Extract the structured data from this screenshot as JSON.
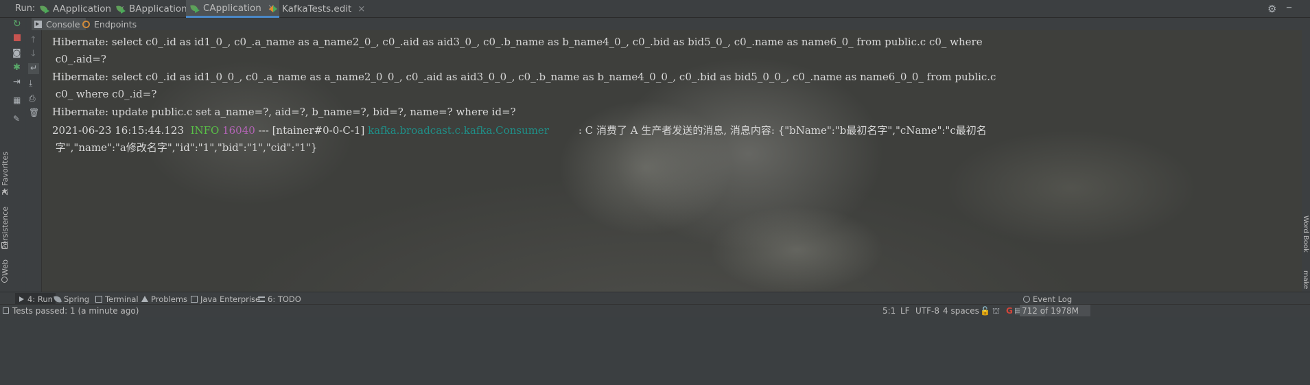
{
  "run_bar": {
    "label": "Run:",
    "tabs": [
      {
        "label": "AApplication",
        "close": "×"
      },
      {
        "label": "BApplication",
        "close": "×"
      },
      {
        "label": "CApplication",
        "close": "×"
      },
      {
        "label": "KafkaTests.edit",
        "close": "×"
      }
    ],
    "settings_icon": "gear-icon",
    "minimize_icon": "minimize-icon"
  },
  "sub_tabs": {
    "console": "Console",
    "endpoints": "Endpoints"
  },
  "left_stripe": {
    "favorites": "2: Favorites",
    "persistence": "Persistence",
    "web": "Web"
  },
  "right_stripe": {
    "word_book": "Word Book",
    "make": "make"
  },
  "console_lines": [
    {
      "text": "Hibernate: select c0_.id as id1_0_, c0_.a_name as a_name2_0_, c0_.aid as aid3_0_, c0_.b_name as b_name4_0_, c0_.bid as bid5_0_, c0_.name as name6_0_ from public.c c0_ where"
    },
    {
      "text": " c0_.aid=?"
    },
    {
      "text": "Hibernate: select c0_.id as id1_0_0_, c0_.a_name as a_name2_0_0_, c0_.aid as aid3_0_0_, c0_.b_name as b_name4_0_0_, c0_.bid as bid5_0_0_, c0_.name as name6_0_0_ from public.c"
    },
    {
      "text": " c0_ where c0_.id=?"
    },
    {
      "text": "Hibernate: update public.c set a_name=?, aid=?, b_name=?, bid=?, name=? where id=?"
    }
  ],
  "log_line": {
    "timestamp": "2021-06-23 16:15:44.123 ",
    "level": " INFO",
    "pid": " 16040",
    "separator": " --- [ntainer#0-0-C-1] ",
    "logger": "kafka.broadcast.c.kafka.Consumer",
    "message": "         : C 消费了 A 生产者发送的消息, 消息内容: {\"bName\":\"b最初名字\",\"cName\":\"c最初名",
    "message_cont": " 字\",\"name\":\"a修改名字\",\"id\":\"1\",\"bid\":\"1\",\"cid\":\"1\"}"
  },
  "bottom_tabs": [
    {
      "label": "4: Run"
    },
    {
      "label": "Spring"
    },
    {
      "label": "Terminal"
    },
    {
      "label": "Problems"
    },
    {
      "label": "Java Enterprise"
    },
    {
      "label": "6: TODO"
    }
  ],
  "event_log": "Event Log",
  "status": {
    "message": "Tests passed: 1 (a minute ago)",
    "position": "5:1",
    "line_sep": "LF",
    "encoding": "UTF-8",
    "indent": "4 spaces",
    "memory": "712 of 1978M",
    "memory_used_fraction": 0.36
  },
  "colors": {
    "info": "#59c247",
    "pid": "#b564b8",
    "logger": "#1f8f88",
    "accent": "#4a88c7"
  }
}
